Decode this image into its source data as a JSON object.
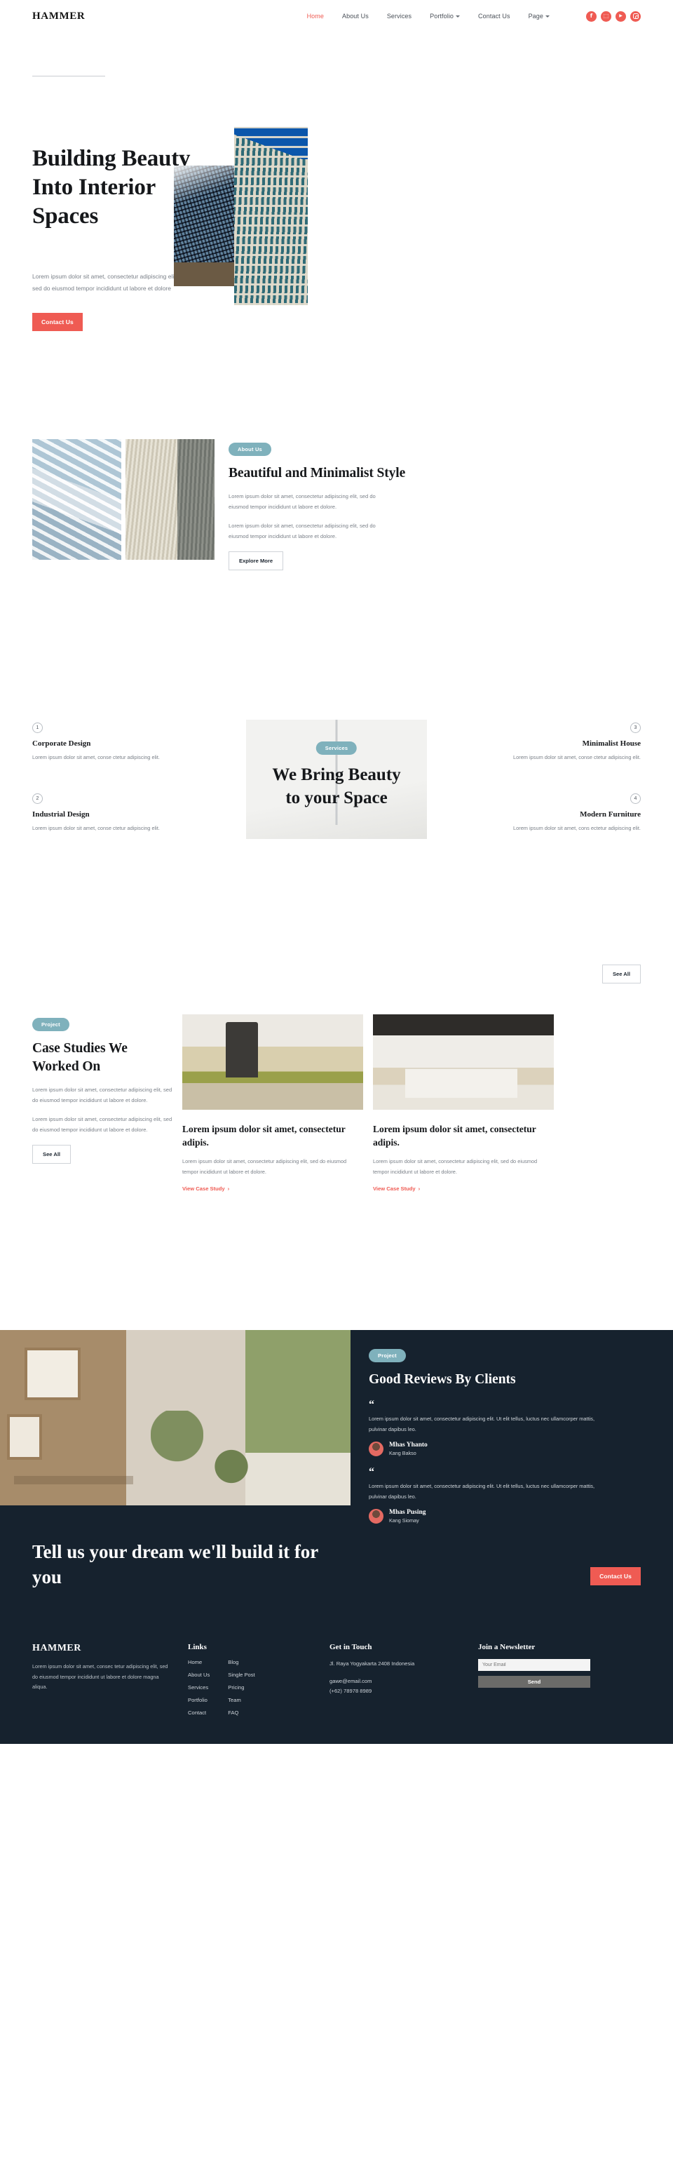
{
  "brand": "HAMMER",
  "nav": {
    "items": [
      {
        "label": "Home",
        "active": true,
        "dropdown": false
      },
      {
        "label": "About Us",
        "active": false,
        "dropdown": false
      },
      {
        "label": "Services",
        "active": false,
        "dropdown": false
      },
      {
        "label": "Portfolio",
        "active": false,
        "dropdown": true
      },
      {
        "label": "Contact Us",
        "active": false,
        "dropdown": false
      },
      {
        "label": "Page",
        "active": false,
        "dropdown": true
      }
    ],
    "socials": [
      {
        "name": "facebook-icon",
        "glyph": "f"
      },
      {
        "name": "twitter-icon",
        "glyph": "t"
      },
      {
        "name": "youtube-icon",
        "glyph": "▶"
      },
      {
        "name": "instagram-icon",
        "glyph": ""
      }
    ]
  },
  "hero": {
    "title": "Building Beauty Into Interior Spaces",
    "subtitle": "Lorem ipsum dolor sit amet, consectetur adipiscing elit, sed do eiusmod tempor incididunt ut labore et dolore",
    "cta": "Contact Us"
  },
  "about": {
    "pill": "About Us",
    "heading": "Beautiful and Minimalist Style",
    "paragraph1": "Lorem ipsum dolor sit amet, consectetur adipiscing elit, sed do eiusmod tempor incididunt ut labore et dolore.",
    "paragraph2": "Lorem ipsum dolor sit amet, consectetur adipiscing elit, sed do eiusmod tempor incididunt ut labore et dolore.",
    "button": "Explore More"
  },
  "services": {
    "pill": "Services",
    "headline_line1": "We Bring Beauty",
    "headline_line2": "to your Space",
    "see_all": "See All",
    "items": [
      {
        "num": "1",
        "title": "Corporate Design",
        "desc": "Lorem ipsum dolor sit amet, conse ctetur adipiscing elit."
      },
      {
        "num": "2",
        "title": "Industrial Design",
        "desc": "Lorem ipsum dolor sit amet, conse ctetur adipiscing elit."
      },
      {
        "num": "3",
        "title": "Minimalist House",
        "desc": "Lorem ipsum dolor sit amet, conse ctetur adipiscing elit."
      },
      {
        "num": "4",
        "title": "Modern Furniture",
        "desc": "Lorem ipsum dolor sit amet, cons ectetur adipiscing elit."
      }
    ]
  },
  "cases": {
    "pill": "Project",
    "heading": "Case Studies We Worked On",
    "paragraph1": "Lorem ipsum dolor sit amet, consectetur adipiscing elit, sed do eiusmod tempor incididunt ut labore et dolore.",
    "paragraph2": "Lorem ipsum dolor sit amet, consectetur adipiscing elit, sed do eiusmod tempor incididunt ut labore et dolore.",
    "see_all": "See All",
    "cards": [
      {
        "title": "Lorem ipsum dolor sit amet, consectetur adipis.",
        "desc": "Lorem ipsum dolor sit amet, consectetur adipiscing elit, sed do eiusmod tempor incididunt ut labore et dolore.",
        "link": "View Case Study"
      },
      {
        "title": "Lorem ipsum dolor sit amet, consectetur adipis.",
        "desc": "Lorem ipsum dolor sit amet, consectetur adipiscing elit, sed do eiusmod tempor incididunt ut labore et dolore.",
        "link": "View Case Study"
      }
    ]
  },
  "reviews": {
    "pill": "Project",
    "heading": "Good Reviews By Clients",
    "items": [
      {
        "quote": "Lorem ipsum dolor sit amet, consectetur adipiscing elit. Ut elit tellus, luctus nec ullamcorper mattis, pulvinar dapibus leo.",
        "name": "Mhas Yhanto",
        "role": "Kang Bakso"
      },
      {
        "quote": "Lorem ipsum dolor sit amet, consectetur adipiscing elit. Ut elit tellus, luctus nec ullamcorper mattis, pulvinar dapibus leo.",
        "name": "Mhas Pusing",
        "role": "Kang Siomay"
      }
    ]
  },
  "cta": {
    "heading": "Tell us your dream we'll build it for you",
    "button": "Contact Us"
  },
  "footer": {
    "logo": "HAMMER",
    "about": "Lorem ipsum dolor sit amet, consec tetur adipiscing elit, sed do eiusmod tempor incididunt ut labore et dolore magna aliqua.",
    "links_heading": "Links",
    "links_col1": [
      "Home",
      "About Us",
      "Services",
      "Portfolio",
      "Contact"
    ],
    "links_col2": [
      "Blog",
      "Single Post",
      "Pricing",
      "Team",
      "FAQ"
    ],
    "touch_heading": "Get in Touch",
    "address": "Jl. Raya Yogyakarta 2408 Indonesia",
    "email": "gawe@email.com",
    "phone": "(+62) 78978 8989",
    "newsletter_heading": "Join a Newsletter",
    "email_placeholder": "Your Email",
    "email_value": "",
    "send_label": "Send"
  },
  "colors": {
    "accent": "#ef5b53",
    "teal": "#7fb1bc",
    "dark": "#16222e"
  }
}
